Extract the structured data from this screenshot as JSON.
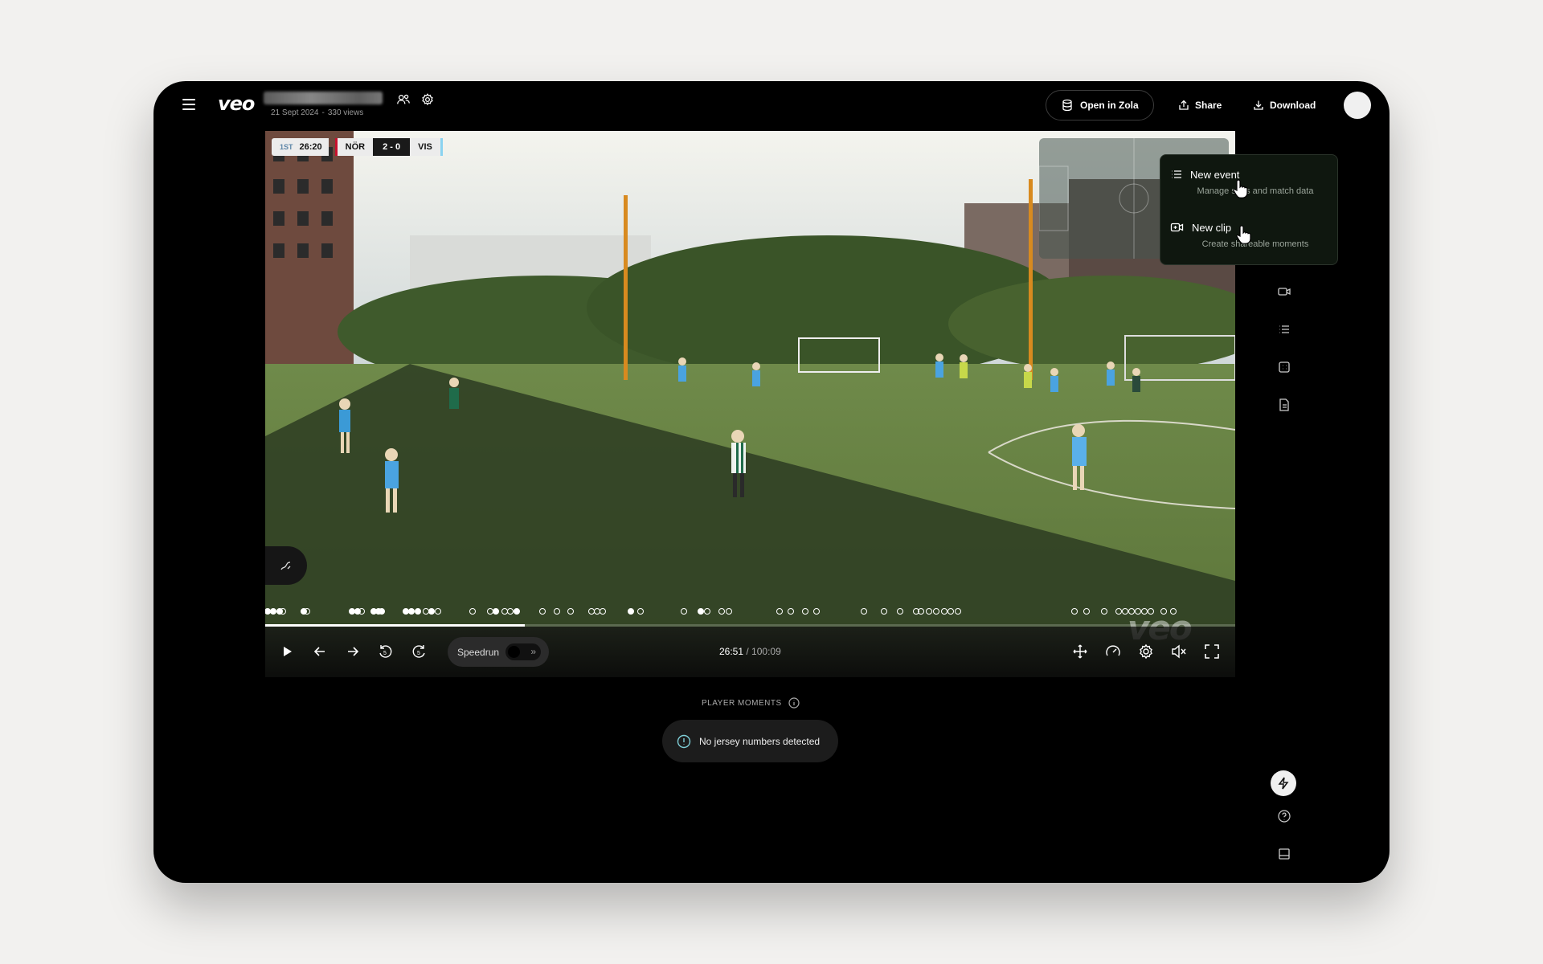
{
  "app": {
    "logo": "veo"
  },
  "header": {
    "subtitle_date": "21 Sept 2024",
    "subtitle_views": "330 views",
    "open_in_zola": "Open in Zola",
    "share": "Share",
    "download": "Download"
  },
  "scoreboard": {
    "period": "1ST",
    "clock": "26:20",
    "home": "NÖR",
    "score": "2 - 0",
    "away": "VIS",
    "home_color": "#c8102e",
    "away_color": "#8ad3f0"
  },
  "player": {
    "current_time": "26:51",
    "separator": " / ",
    "duration": "100:09",
    "progress": 0.268,
    "speedrun_label": "Speedrun",
    "speedrun_on": false,
    "watermark": "veo"
  },
  "player_moments": {
    "label": "PLAYER MOMENTS",
    "message": "No jersey numbers detected"
  },
  "create_menu": {
    "items": [
      {
        "label": "New event",
        "description": "Manage stats and match data",
        "icon": "list-icon"
      },
      {
        "label": "New clip",
        "description": "Create shareable moments",
        "icon": "video-plus-icon"
      }
    ]
  },
  "right_rail": {
    "icons": [
      "close-icon",
      "stats-icon",
      "jersey-icon",
      "video-icon",
      "list-icon",
      "grid-icon",
      "document-icon",
      "bolt-icon",
      "help-icon",
      "book-icon"
    ]
  },
  "colors": {
    "background": "#f2f1ef",
    "frame": "#000000",
    "menu_bg": "#0f170f",
    "accent_green": "#3ddc84"
  }
}
